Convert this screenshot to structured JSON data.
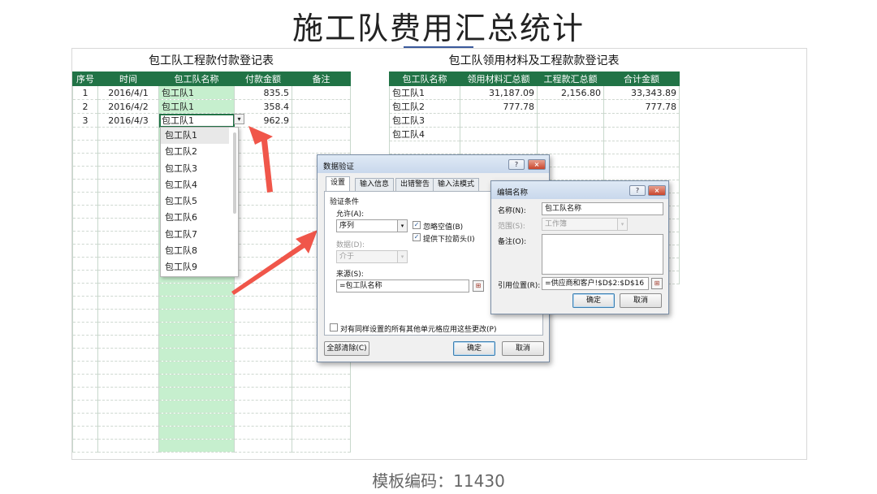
{
  "page": {
    "title": "施工队费用汇总统计",
    "footer": "模板编码：11430"
  },
  "left_table": {
    "title": "包工队工程款付款登记表",
    "headers": [
      "序号",
      "时间",
      "包工队名称",
      "付款金额",
      "备注"
    ],
    "rows": [
      [
        "1",
        "2016/4/1",
        "包工队1",
        "835.5",
        ""
      ],
      [
        "2",
        "2016/4/2",
        "包工队1",
        "358.4",
        ""
      ],
      [
        "3",
        "2016/4/3",
        "包工队1",
        "962.9",
        ""
      ]
    ],
    "dropdown_items": [
      "包工队1",
      "包工队2",
      "包工队3",
      "包工队4",
      "包工队5",
      "包工队6",
      "包工队7",
      "包工队8",
      "包工队9"
    ]
  },
  "right_table": {
    "title": "包工队领用材料及工程款款登记表",
    "headers": [
      "包工队名称",
      "领用材料汇总额",
      "工程款汇总额",
      "合计金额"
    ],
    "rows": [
      [
        "包工队1",
        "31,187.09",
        "2,156.80",
        "33,343.89"
      ],
      [
        "包工队2",
        "777.78",
        "",
        "777.78"
      ],
      [
        "包工队3",
        "",
        "",
        ""
      ],
      [
        "包工队4",
        "",
        "",
        ""
      ]
    ]
  },
  "validation_dialog": {
    "title": "数据验证",
    "help": "?",
    "close": "×",
    "tabs": [
      "设置",
      "输入信息",
      "出错警告",
      "输入法模式"
    ],
    "group_label": "验证条件",
    "allow_label": "允许(A):",
    "allow_value": "序列",
    "ignore_blank": "忽略空值(B)",
    "dropdown_arrow": "提供下拉箭头(I)",
    "data_label": "数据(D):",
    "data_value": "介于",
    "source_label": "来源(S):",
    "source_value": "=包工队名称",
    "apply_all": "对有同样设置的所有其他单元格应用这些更改(P)",
    "clear_all": "全部清除(C)",
    "ok": "确定",
    "cancel": "取消"
  },
  "name_dialog": {
    "title": "编辑名称",
    "help": "?",
    "close": "×",
    "name_label": "名称(N):",
    "name_value": "包工队名称",
    "scope_label": "范围(S):",
    "scope_value": "工作簿",
    "comment_label": "备注(O):",
    "ref_label": "引用位置(R):",
    "ref_value": "=供应商和客户!$D$2:$D$16",
    "ok": "确定",
    "cancel": "取消"
  },
  "colors": {
    "header_green": "#217346",
    "highlight_green": "#c6efce",
    "arrow_red": "#f0564a"
  },
  "icons": {
    "dropdown": "▾",
    "check": "✓",
    "ref_picker": "⊞"
  }
}
